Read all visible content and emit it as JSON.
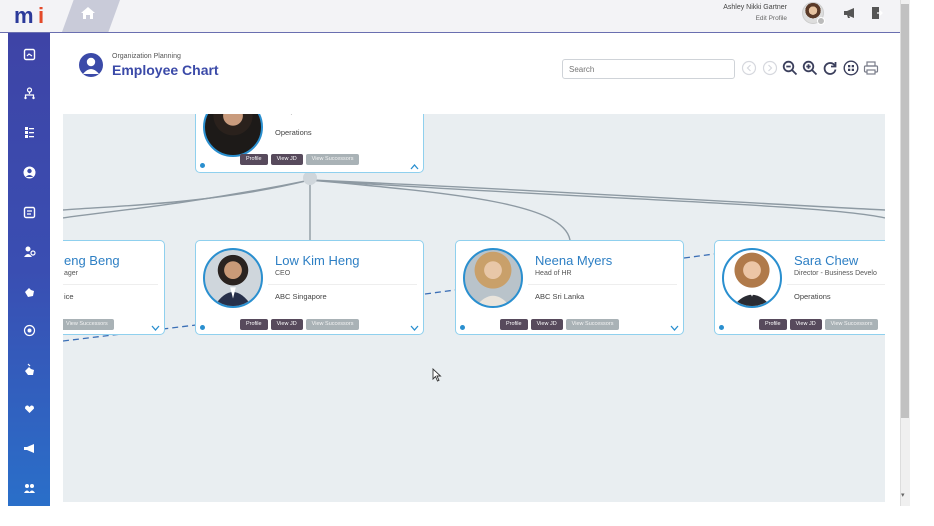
{
  "app": {
    "logo_text": "mi",
    "logo_sub": "mi"
  },
  "topbar": {
    "user_name": "Ashley Nikki Gartner",
    "edit_profile": "Edit Profile"
  },
  "header": {
    "breadcrumb": "Organization Planning",
    "title": "Employee Chart"
  },
  "search": {
    "placeholder": "Search"
  },
  "colors": {
    "accent": "#3b4aa8",
    "name_blue": "#2d7fc4",
    "card_border": "#8fd0ee",
    "button_dark": "#574a5c",
    "button_light": "#a9b2b6"
  },
  "chart": {
    "top_card": {
      "role": "Group CEO",
      "location": "Operations",
      "buttons": {
        "profile": "Profile",
        "view_jd": "View JD",
        "view_successors": "View Successors"
      }
    },
    "cards": [
      {
        "name": "eng Beng",
        "role": "ager",
        "location": "ice",
        "buttons": {
          "view_successors": "View Successors"
        }
      },
      {
        "name": "Low Kim Heng",
        "role": "CEO",
        "location": "ABC Singapore",
        "buttons": {
          "profile": "Profile",
          "view_jd": "View JD",
          "view_successors": "View Successors"
        }
      },
      {
        "name": "Neena Myers",
        "role": "Head of HR",
        "location": "ABC Sri Lanka",
        "buttons": {
          "profile": "Profile",
          "view_jd": "View JD",
          "view_successors": "View Successors"
        }
      },
      {
        "name": "Sara Chew",
        "role": "Director - Business Develo",
        "location": "Operations",
        "buttons": {
          "profile": "Profile",
          "view_jd": "View JD",
          "view_successors": "View Successors"
        }
      }
    ]
  },
  "icons": {
    "home": "home-icon",
    "announcement": "megaphone-icon",
    "logout": "logout-icon",
    "zoom_out": "zoom-out-icon",
    "zoom_in": "zoom-in-icon",
    "refresh": "refresh-icon",
    "fit": "fit-screen-icon",
    "print": "print-icon",
    "sidebar": [
      "dashboard-icon",
      "org-chart-icon",
      "list-icon",
      "person-icon",
      "document-icon",
      "people-settings-icon",
      "hand-icon",
      "target-icon",
      "hand-up-icon",
      "heart-hand-icon",
      "megaphone-icon",
      "group-icon"
    ]
  }
}
